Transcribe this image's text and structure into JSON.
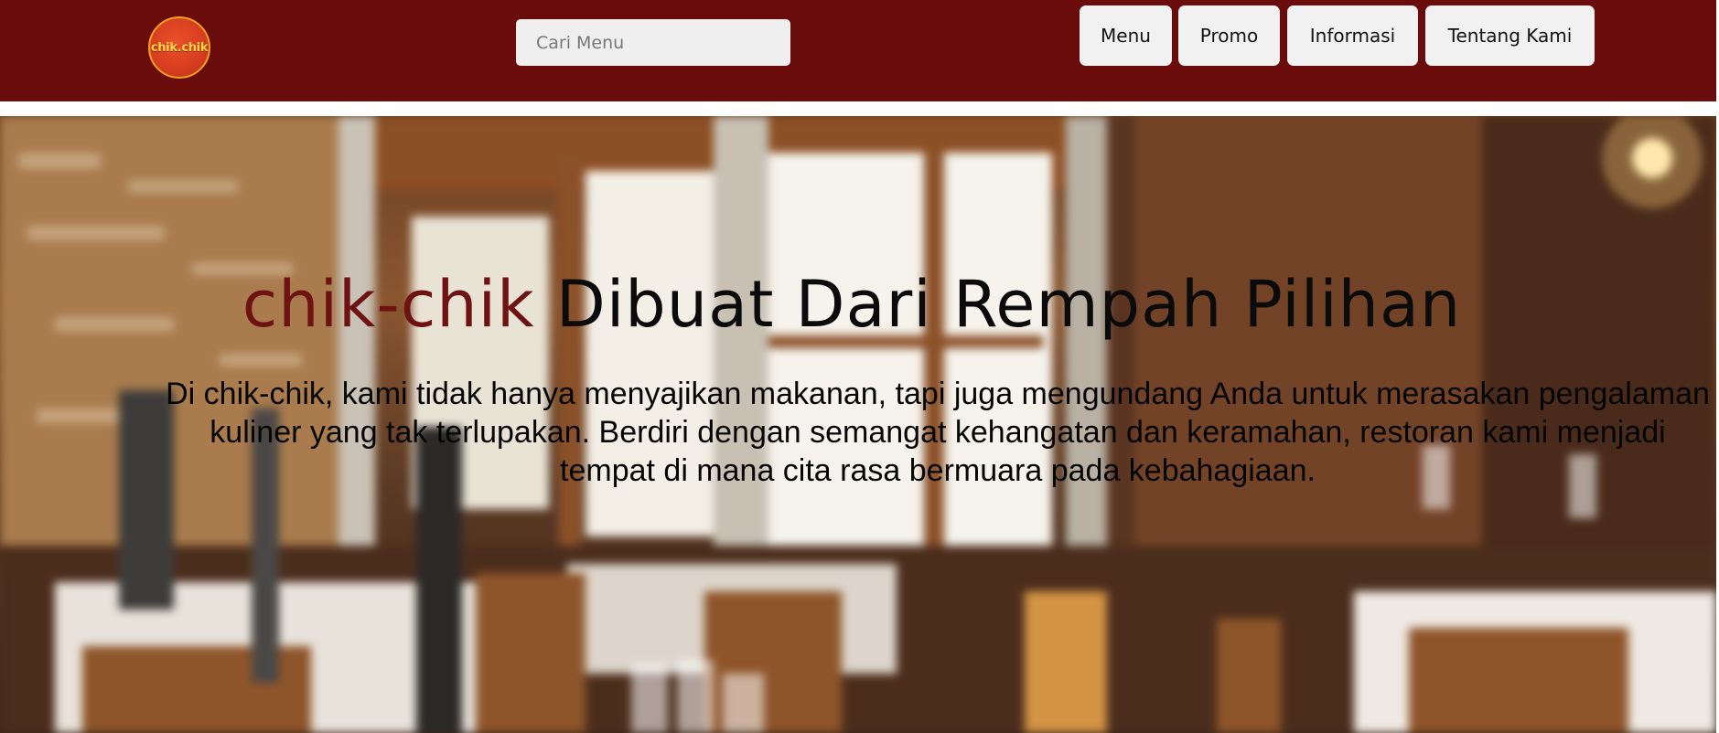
{
  "header": {
    "logo_text": "chik.chik",
    "search_placeholder": "Cari Menu",
    "nav": [
      {
        "label": "Menu"
      },
      {
        "label": "Promo"
      },
      {
        "label": "Informasi"
      },
      {
        "label": "Tentang Kami"
      }
    ],
    "background_color": "#6b0c0c"
  },
  "hero": {
    "brand_name": "chik-chik",
    "headline": "Dibuat Dari Rempah Pilihan",
    "description": "Di chik-chik, kami tidak hanya menyajikan makanan, tapi juga mengundang Anda untuk merasakan pengalaman kuliner yang tak terlupakan. Berdiri dengan semangat kehangatan dan keramahan, restoran kami menjadi tempat di mana cita rasa bermuara pada kebahagiaan.",
    "brand_color": "#6f1212"
  }
}
